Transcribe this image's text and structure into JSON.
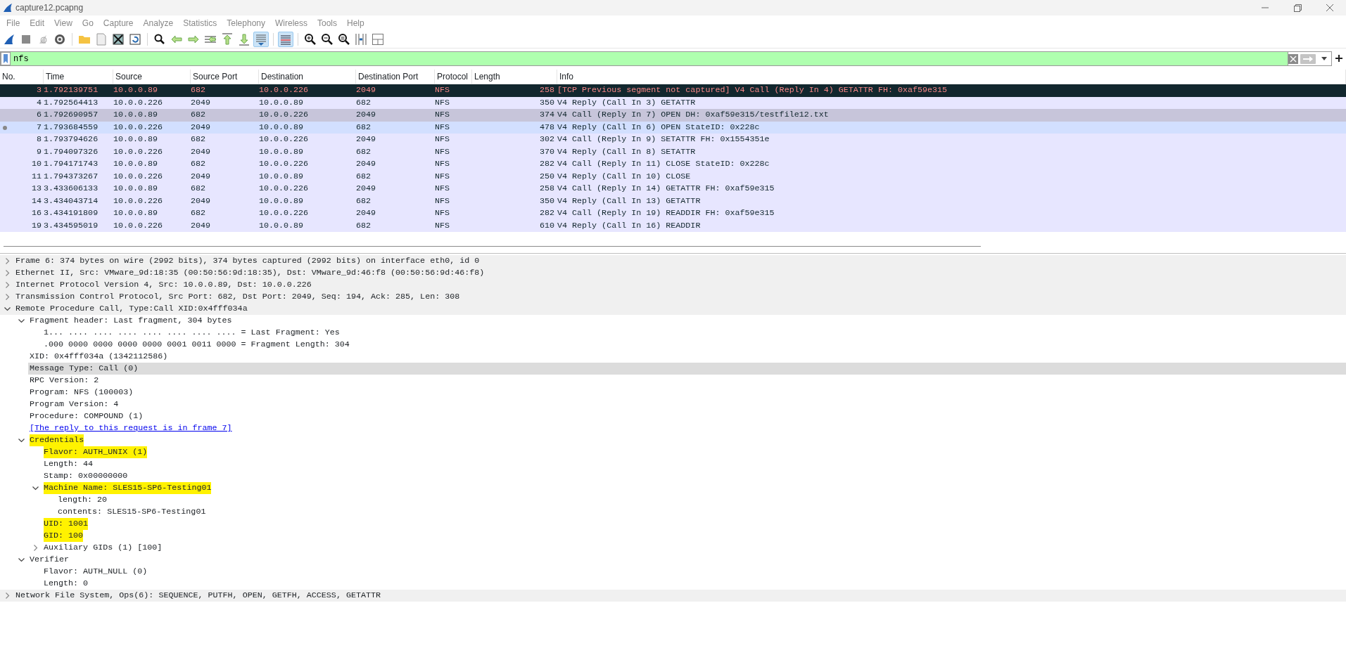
{
  "window": {
    "title": "capture12.pcapng"
  },
  "menu": [
    "File",
    "Edit",
    "View",
    "Go",
    "Capture",
    "Analyze",
    "Statistics",
    "Telephony",
    "Wireless",
    "Tools",
    "Help"
  ],
  "toolbar": [
    {
      "pressed": false
    },
    {
      "pressed": false
    },
    {
      "pressed": false
    },
    {
      "pressed": false
    },
    {
      "pressed": false
    },
    {
      "pressed": false
    },
    {
      "pressed": false
    },
    {
      "pressed": false
    },
    {
      "pressed": false
    },
    {
      "pressed": false
    },
    {
      "pressed": false
    },
    {
      "pressed": false
    },
    {
      "pressed": false
    },
    {
      "pressed": false
    },
    {
      "pressed": true
    },
    {
      "pressed": true
    },
    {
      "pressed": false
    },
    {
      "pressed": false
    },
    {
      "pressed": false
    },
    {
      "pressed": false
    },
    {
      "pressed": false
    }
  ],
  "filter": {
    "value": "nfs"
  },
  "packet_list": {
    "columns": [
      "No.",
      "Time",
      "Source",
      "Source Port",
      "Destination",
      "Destination Port",
      "Protocol",
      "Length",
      "Info"
    ],
    "rows": [
      {
        "kind": "error",
        "selected": false,
        "related": false,
        "cells": [
          "3",
          "1.792139751",
          "10.0.0.89",
          "682",
          "10.0.0.226",
          "2049",
          "NFS",
          "258",
          "[TCP Previous segment not captured] V4 Call (Reply In 4) GETATTR FH: 0xaf59e315"
        ]
      },
      {
        "kind": "normal",
        "selected": false,
        "related": false,
        "cells": [
          "4",
          "1.792564413",
          "10.0.0.226",
          "2049",
          "10.0.0.89",
          "682",
          "NFS",
          "350",
          "V4 Reply (Call In 3) GETATTR"
        ]
      },
      {
        "kind": "normal",
        "selected": true,
        "related": false,
        "cells": [
          "6",
          "1.792690957",
          "10.0.0.89",
          "682",
          "10.0.0.226",
          "2049",
          "NFS",
          "374",
          "V4 Call (Reply In 7) OPEN DH: 0xaf59e315/testfile12.txt"
        ]
      },
      {
        "kind": "normal",
        "selected": false,
        "related": true,
        "cells": [
          "7",
          "1.793684559",
          "10.0.0.226",
          "2049",
          "10.0.0.89",
          "682",
          "NFS",
          "478",
          "V4 Reply (Call In 6) OPEN StateID: 0x228c"
        ]
      },
      {
        "kind": "normal",
        "selected": false,
        "related": false,
        "cells": [
          "8",
          "1.793794626",
          "10.0.0.89",
          "682",
          "10.0.0.226",
          "2049",
          "NFS",
          "302",
          "V4 Call (Reply In 9) SETATTR FH: 0x1554351e"
        ]
      },
      {
        "kind": "normal",
        "selected": false,
        "related": false,
        "cells": [
          "9",
          "1.794097326",
          "10.0.0.226",
          "2049",
          "10.0.0.89",
          "682",
          "NFS",
          "370",
          "V4 Reply (Call In 8) SETATTR"
        ]
      },
      {
        "kind": "normal",
        "selected": false,
        "related": false,
        "cells": [
          "10",
          "1.794171743",
          "10.0.0.89",
          "682",
          "10.0.0.226",
          "2049",
          "NFS",
          "282",
          "V4 Call (Reply In 11) CLOSE StateID: 0x228c"
        ]
      },
      {
        "kind": "normal",
        "selected": false,
        "related": false,
        "cells": [
          "11",
          "1.794373267",
          "10.0.0.226",
          "2049",
          "10.0.0.89",
          "682",
          "NFS",
          "250",
          "V4 Reply (Call In 10) CLOSE"
        ]
      },
      {
        "kind": "normal",
        "selected": false,
        "related": false,
        "cells": [
          "13",
          "3.433606133",
          "10.0.0.89",
          "682",
          "10.0.0.226",
          "2049",
          "NFS",
          "258",
          "V4 Call (Reply In 14) GETATTR FH: 0xaf59e315"
        ]
      },
      {
        "kind": "normal",
        "selected": false,
        "related": false,
        "cells": [
          "14",
          "3.434043714",
          "10.0.0.226",
          "2049",
          "10.0.0.89",
          "682",
          "NFS",
          "350",
          "V4 Reply (Call In 13) GETATTR"
        ]
      },
      {
        "kind": "normal",
        "selected": false,
        "related": false,
        "cells": [
          "16",
          "3.434191809",
          "10.0.0.89",
          "682",
          "10.0.0.226",
          "2049",
          "NFS",
          "282",
          "V4 Call (Reply In 19) READDIR FH: 0xaf59e315"
        ]
      },
      {
        "kind": "normal",
        "selected": false,
        "related": false,
        "cells": [
          "19",
          "3.434595019",
          "10.0.0.226",
          "2049",
          "10.0.0.89",
          "682",
          "NFS",
          "610",
          "V4 Reply (Call In 16) READDIR"
        ]
      }
    ]
  },
  "details": [
    {
      "text": "Frame 6: 374 bytes on wire (2992 bits), 374 bytes captured (2992 bits) on interface eth0, id 0",
      "kind": "field",
      "expanded": false,
      "selected": false,
      "highlighted": false
    },
    {
      "text": "Ethernet II, Src: VMware_9d:18:35 (00:50:56:9d:18:35), Dst: VMware_9d:46:f8 (00:50:56:9d:46:f8)",
      "kind": "field",
      "expanded": false,
      "selected": false,
      "highlighted": false
    },
    {
      "text": "Internet Protocol Version 4, Src: 10.0.0.89, Dst: 10.0.0.226",
      "kind": "field",
      "expanded": false,
      "selected": false,
      "highlighted": false
    },
    {
      "text": "Transmission Control Protocol, Src Port: 682, Dst Port: 2049, Seq: 194, Ack: 285, Len: 308",
      "kind": "field",
      "expanded": false,
      "selected": false,
      "highlighted": false
    },
    {
      "text": "Remote Procedure Call, Type:Call XID:0x4fff034a",
      "kind": "field",
      "expanded": true,
      "selected": false,
      "highlighted": false,
      "children": [
        {
          "text": "Fragment header: Last fragment, 304 bytes",
          "kind": "field",
          "expanded": true,
          "selected": false,
          "highlighted": false,
          "children": [
            {
              "text": "1... .... .... .... .... .... .... .... = Last Fragment: Yes",
              "kind": "field",
              "selected": false,
              "highlighted": false
            },
            {
              "text": ".000 0000 0000 0000 0000 0001 0011 0000 = Fragment Length: 304",
              "kind": "field",
              "selected": false,
              "highlighted": false
            }
          ]
        },
        {
          "text": "XID: 0x4fff034a (1342112586)",
          "kind": "field",
          "selected": false,
          "highlighted": false
        },
        {
          "text": "Message Type: Call (0)",
          "kind": "field",
          "selected": true,
          "highlighted": false
        },
        {
          "text": "RPC Version: 2",
          "kind": "field",
          "selected": false,
          "highlighted": false
        },
        {
          "text": "Program: NFS (100003)",
          "kind": "field",
          "selected": false,
          "highlighted": false
        },
        {
          "text": "Program Version: 4",
          "kind": "field",
          "selected": false,
          "highlighted": false
        },
        {
          "text": "Procedure: COMPOUND (1)",
          "kind": "field",
          "selected": false,
          "highlighted": false
        },
        {
          "text": "[The reply to this request is in frame 7]",
          "kind": "link",
          "selected": false,
          "highlighted": false
        },
        {
          "text": "Credentials",
          "kind": "field",
          "expanded": true,
          "selected": false,
          "highlighted": true,
          "children": [
            {
              "text": "Flavor: AUTH_UNIX (1)",
              "kind": "field",
              "selected": false,
              "highlighted": true
            },
            {
              "text": "Length: 44",
              "kind": "field",
              "selected": false,
              "highlighted": false
            },
            {
              "text": "Stamp: 0x00000000",
              "kind": "field",
              "selected": false,
              "highlighted": false
            },
            {
              "text": "Machine Name: SLES15-SP6-Testing01",
              "kind": "field",
              "expanded": true,
              "selected": false,
              "highlighted": true,
              "children": [
                {
                  "text": "length: 20",
                  "kind": "field",
                  "selected": false,
                  "highlighted": false
                },
                {
                  "text": "contents: SLES15-SP6-Testing01",
                  "kind": "field",
                  "selected": false,
                  "highlighted": false
                }
              ]
            },
            {
              "text": "UID: 1001",
              "kind": "field",
              "selected": false,
              "highlighted": true
            },
            {
              "text": "GID: 100",
              "kind": "field",
              "selected": false,
              "highlighted": true
            },
            {
              "text": "Auxiliary GIDs (1) [100]",
              "kind": "field",
              "expanded": false,
              "selected": false,
              "highlighted": false
            }
          ]
        },
        {
          "text": "Verifier",
          "kind": "field",
          "expanded": true,
          "selected": false,
          "highlighted": false,
          "children": [
            {
              "text": "Flavor: AUTH_NULL (0)",
              "kind": "field",
              "selected": false,
              "highlighted": false
            },
            {
              "text": "Length: 0",
              "kind": "field",
              "selected": false,
              "highlighted": false
            }
          ]
        }
      ]
    },
    {
      "text": "Network File System, Ops(6): SEQUENCE, PUTFH, OPEN, GETFH, ACCESS, GETATTR",
      "kind": "field",
      "expanded": false,
      "selected": false,
      "highlighted": false
    }
  ]
}
